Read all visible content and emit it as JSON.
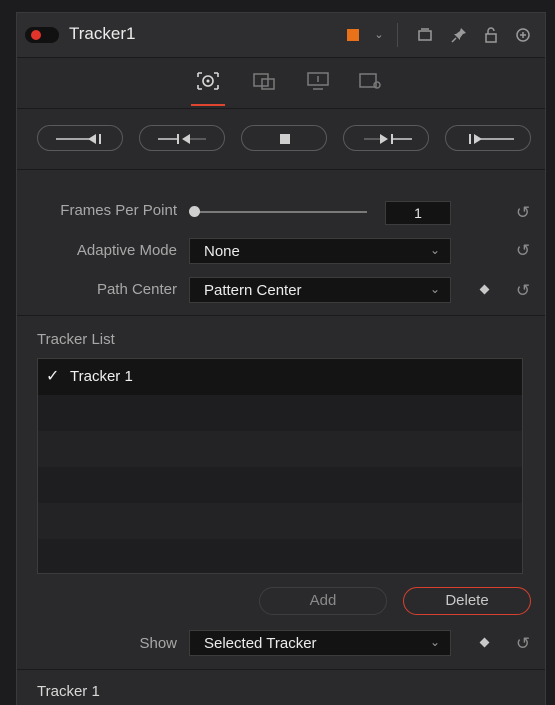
{
  "header": {
    "title": "Tracker1",
    "accent_color": "#e8711a",
    "icons": [
      "tile-icon",
      "pin-icon",
      "lock-icon",
      "reset-icon"
    ]
  },
  "tabs": [
    {
      "name": "tracker-tab",
      "active": true
    },
    {
      "name": "operation-tab",
      "active": false
    },
    {
      "name": "display-tab",
      "active": false
    },
    {
      "name": "settings-tab",
      "active": false
    }
  ],
  "transport": [
    "track-reverse-from-end",
    "track-reverse",
    "stop",
    "track-forward",
    "track-forward-from-start"
  ],
  "controls": {
    "frames_per_point_label": "Frames Per Point",
    "frames_per_point_value": "1",
    "frames_per_point_slider_level": 0.0,
    "adaptive_mode_label": "Adaptive Mode",
    "adaptive_mode_value": "None",
    "path_center_label": "Path Center",
    "path_center_value": "Pattern Center"
  },
  "tracker_list": {
    "title": "Tracker List",
    "items": [
      {
        "label": "Tracker 1",
        "checked": true,
        "selected": true
      }
    ],
    "add_label": "Add",
    "delete_label": "Delete",
    "show_label": "Show",
    "show_value": "Selected Tracker"
  },
  "footer": {
    "title": "Tracker 1"
  }
}
